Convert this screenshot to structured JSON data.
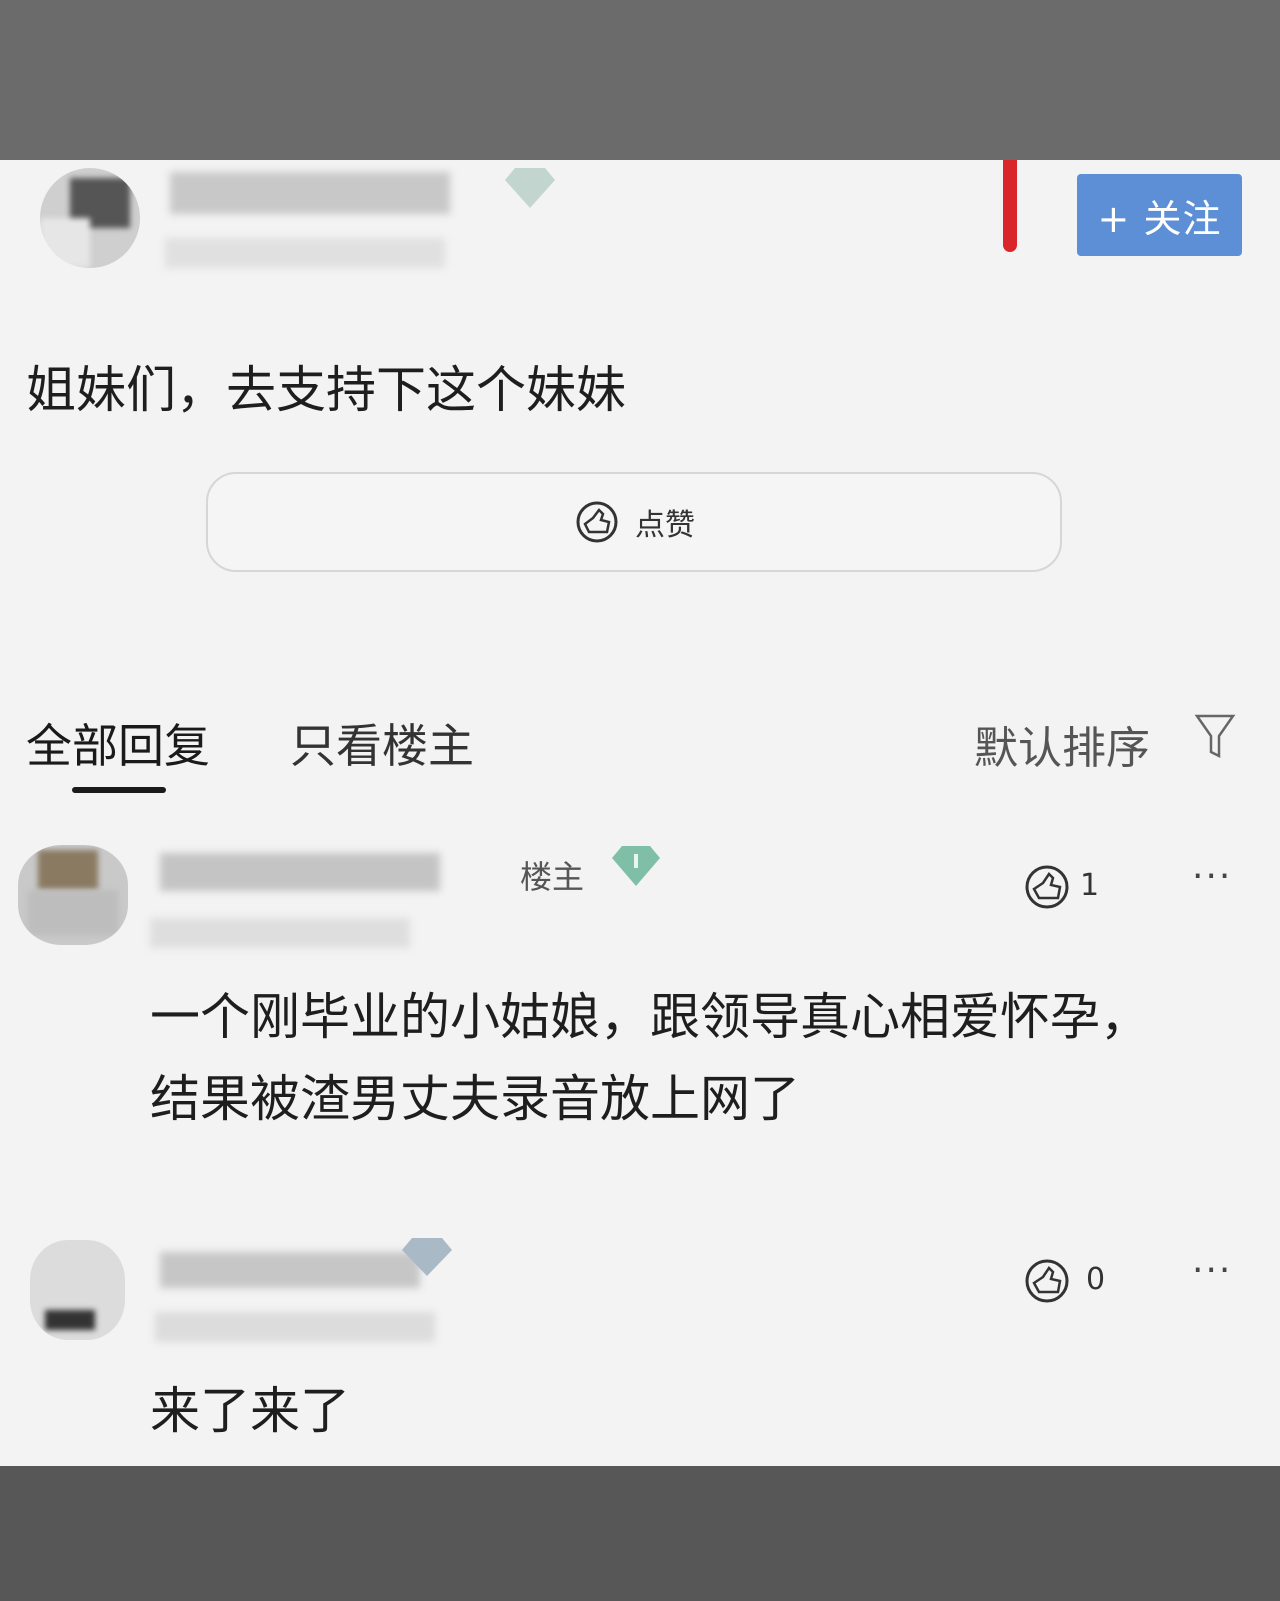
{
  "colors": {
    "follow_button": "#5d8fd6",
    "badge_diamond": "#7fbfa8",
    "red_mark": "#d8262a",
    "panel_background": "#f3f3f3"
  },
  "post": {
    "follow_label": "+ 关注",
    "text": "姐妹们，去支持下这个妹妹",
    "like_label": "点赞",
    "like_icon": "thumbs-up-icon"
  },
  "tabs": {
    "all_replies": "全部回复",
    "op_only": "只看楼主",
    "sort_label": "默认排序",
    "filter_icon": "filter-icon"
  },
  "replies": [
    {
      "badge": "楼主",
      "like_count": "1",
      "more_label": "···",
      "lines": [
        "一个刚毕业的小姑娘，跟领导真心相爱怀孕，",
        "结果被渣男丈夫录音放上网了"
      ]
    },
    {
      "like_count": "0",
      "more_label": "···",
      "text": "来了来了"
    }
  ]
}
